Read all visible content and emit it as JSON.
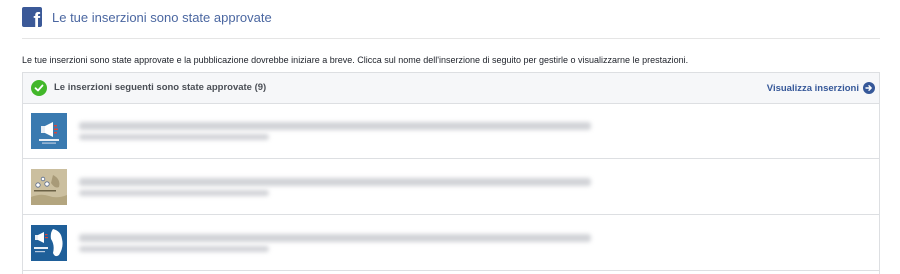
{
  "header": {
    "logo_icon": "facebook-logo-icon",
    "logo_glyph": "f",
    "title": "Le tue inserzioni sono state approvate"
  },
  "intro_text": "Le tue inserzioni sono state approvate e la pubblicazione dovrebbe iniziare a breve. Clicca sul nome dell'inserzione di seguito per gestirle o visualizzarne le prestazioni.",
  "panel": {
    "status_icon": "check-circle-icon",
    "title": "Le inserzioni seguenti sono state approvate (9)",
    "action_label": "Visualizza inserzioni",
    "action_icon": "arrow-right-circle-icon"
  },
  "ads": [
    {
      "thumbnail": "megaphone-thumbnail"
    },
    {
      "thumbnail": "map-thumbnail"
    },
    {
      "thumbnail": "megaphone-map-thumbnail"
    }
  ],
  "colors": {
    "brand": "#3b5998",
    "link": "#365899",
    "success": "#42b72a"
  }
}
